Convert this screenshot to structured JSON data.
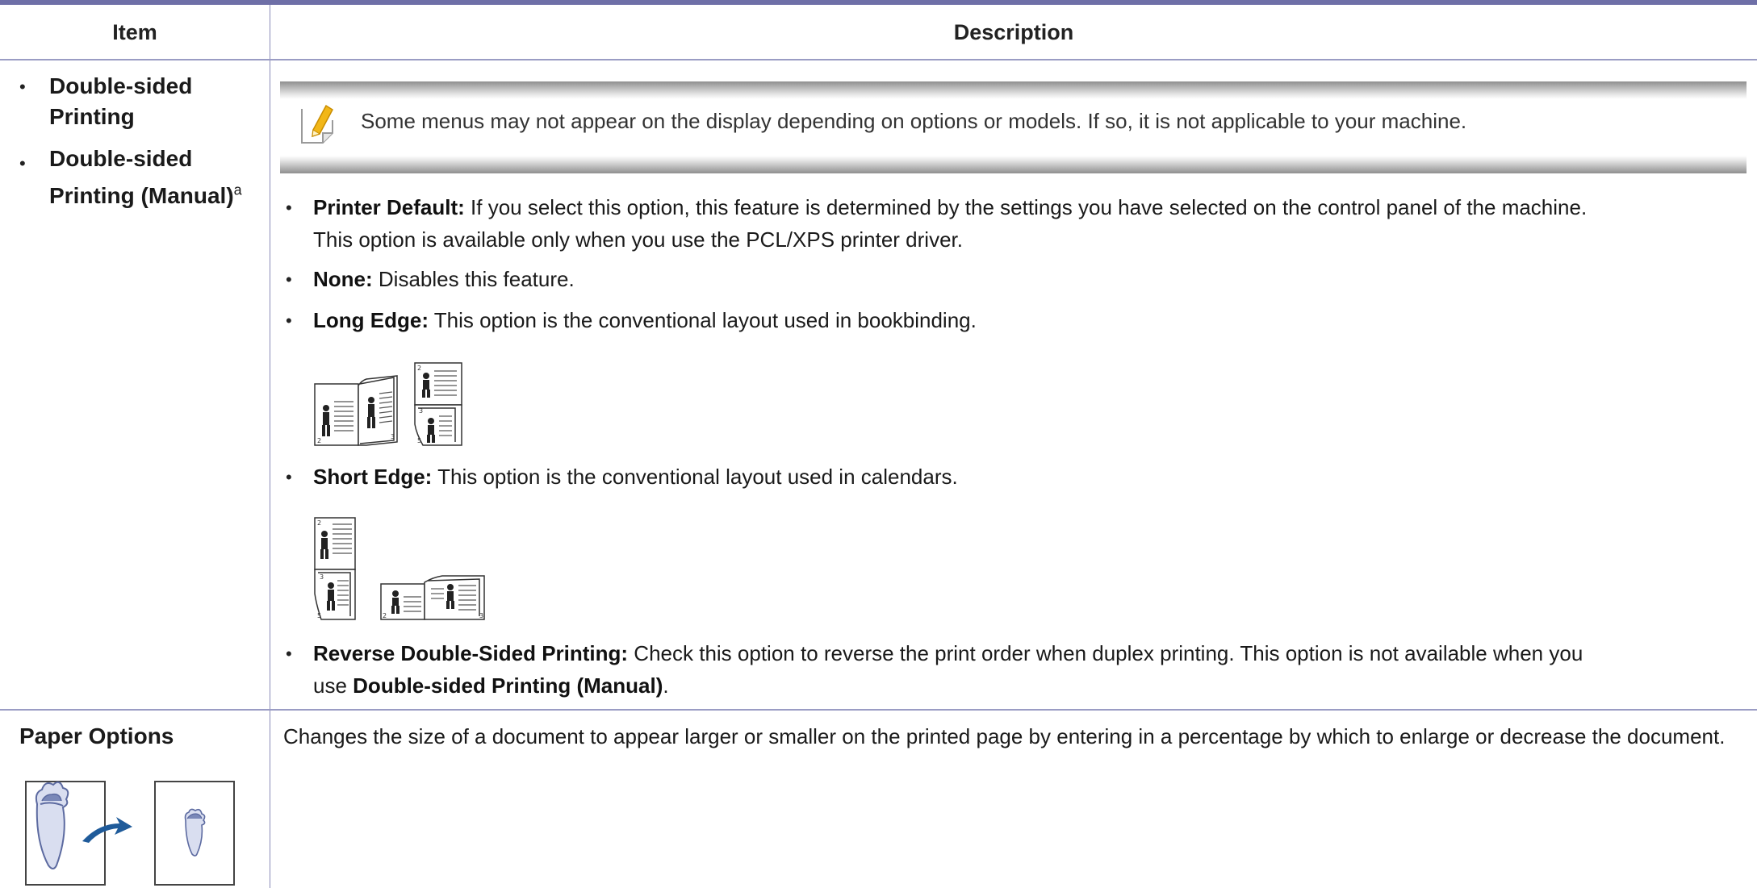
{
  "table": {
    "headers": {
      "item": "Item",
      "description": "Description"
    },
    "rows": [
      {
        "items": [
          {
            "text": "Double-sided Printing",
            "line1": "Double-sided",
            "line2": "Printing"
          },
          {
            "text": "Double-sided Printing (Manual)",
            "line1": "Double-sided",
            "line2": "Printing (Manual)",
            "footnote": "a"
          }
        ],
        "note": "Some menus may not appear on the display depending on options or models. If so, it is not applicable to your machine.",
        "options": [
          {
            "label": "Printer Default:",
            "text": " If you select this option, this feature is determined by the settings you have selected on the control panel of the machine.",
            "text2": "This option is available only when you use the PCL/XPS printer driver."
          },
          {
            "label": "None:",
            "text": " Disables this feature."
          },
          {
            "label": "Long Edge:",
            "text": " This option is the conventional layout used in bookbinding.",
            "page_numbers": [
              "2",
              "3",
              "2",
              "3",
              "5"
            ]
          },
          {
            "label": "Short Edge:",
            "text": " This option is the conventional layout used in calendars.",
            "page_numbers": [
              "2",
              "3",
              "5",
              "2",
              "3"
            ]
          },
          {
            "label": "Reverse Double-Sided Printing:",
            "text": " Check this option to reverse the print order when duplex printing. This option is not available when you",
            "text2_prefix": "use ",
            "text2_bold": "Double-sided Printing (Manual)",
            "text2_suffix": "."
          }
        ]
      },
      {
        "item": "Paper Options",
        "description": "Changes the size of a document to appear larger or smaller on the printed page by entering in a percentage by which to enlarge or decrease the document."
      }
    ]
  },
  "colors": {
    "rule": "#6e6fa7",
    "note_bar": "#8f8f8f",
    "illustration": "#7a88b8",
    "arrow": "#1f5b9a"
  },
  "icons": {
    "note": "note-pencil-icon",
    "long_edge": "long-edge-illustration",
    "short_edge": "short-edge-illustration",
    "paper": "scaling-illustration"
  }
}
